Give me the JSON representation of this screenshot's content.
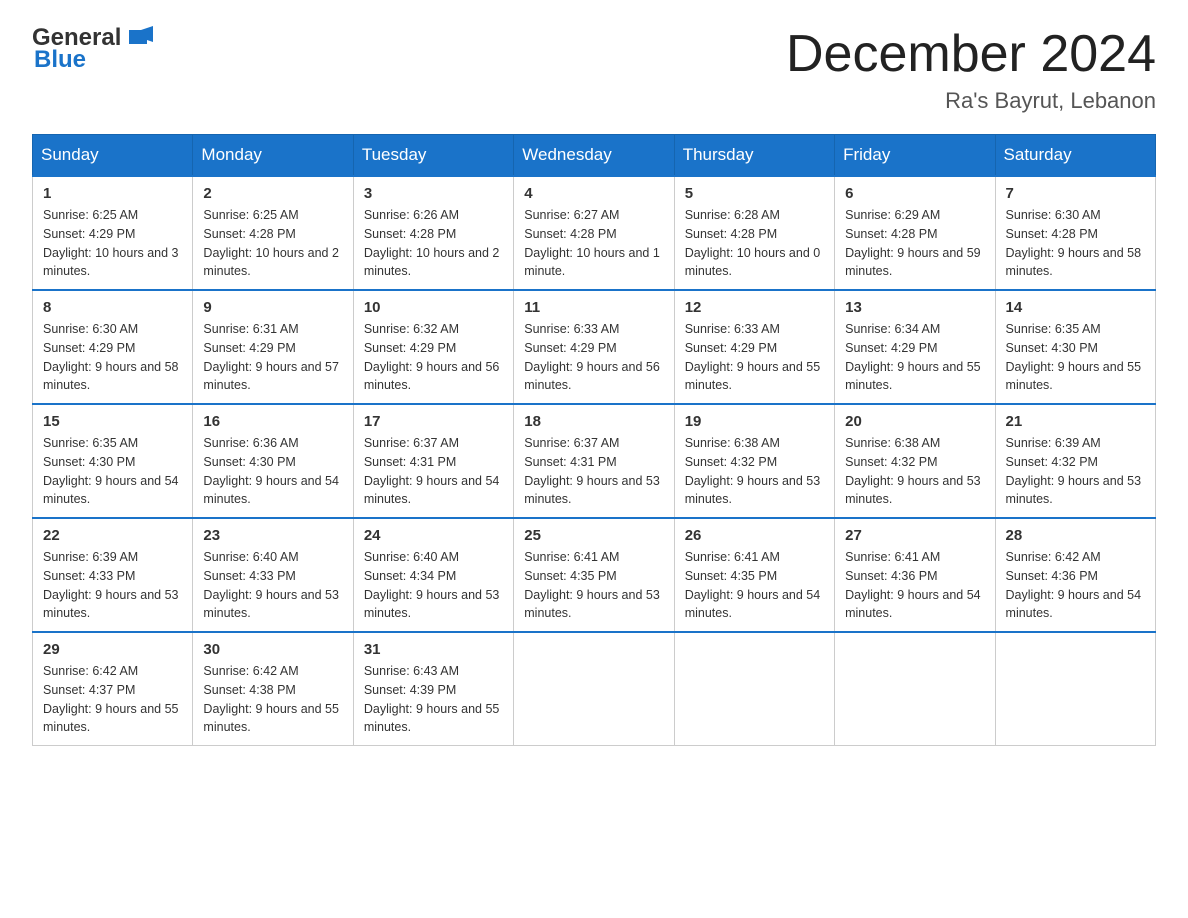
{
  "logo": {
    "text_general": "General",
    "text_blue": "Blue"
  },
  "header": {
    "title": "December 2024",
    "subtitle": "Ra's Bayrut, Lebanon"
  },
  "weekdays": [
    "Sunday",
    "Monday",
    "Tuesday",
    "Wednesday",
    "Thursday",
    "Friday",
    "Saturday"
  ],
  "weeks": [
    [
      {
        "day": "1",
        "sunrise": "6:25 AM",
        "sunset": "4:29 PM",
        "daylight": "10 hours and 3 minutes."
      },
      {
        "day": "2",
        "sunrise": "6:25 AM",
        "sunset": "4:28 PM",
        "daylight": "10 hours and 2 minutes."
      },
      {
        "day": "3",
        "sunrise": "6:26 AM",
        "sunset": "4:28 PM",
        "daylight": "10 hours and 2 minutes."
      },
      {
        "day": "4",
        "sunrise": "6:27 AM",
        "sunset": "4:28 PM",
        "daylight": "10 hours and 1 minute."
      },
      {
        "day": "5",
        "sunrise": "6:28 AM",
        "sunset": "4:28 PM",
        "daylight": "10 hours and 0 minutes."
      },
      {
        "day": "6",
        "sunrise": "6:29 AM",
        "sunset": "4:28 PM",
        "daylight": "9 hours and 59 minutes."
      },
      {
        "day": "7",
        "sunrise": "6:30 AM",
        "sunset": "4:28 PM",
        "daylight": "9 hours and 58 minutes."
      }
    ],
    [
      {
        "day": "8",
        "sunrise": "6:30 AM",
        "sunset": "4:29 PM",
        "daylight": "9 hours and 58 minutes."
      },
      {
        "day": "9",
        "sunrise": "6:31 AM",
        "sunset": "4:29 PM",
        "daylight": "9 hours and 57 minutes."
      },
      {
        "day": "10",
        "sunrise": "6:32 AM",
        "sunset": "4:29 PM",
        "daylight": "9 hours and 56 minutes."
      },
      {
        "day": "11",
        "sunrise": "6:33 AM",
        "sunset": "4:29 PM",
        "daylight": "9 hours and 56 minutes."
      },
      {
        "day": "12",
        "sunrise": "6:33 AM",
        "sunset": "4:29 PM",
        "daylight": "9 hours and 55 minutes."
      },
      {
        "day": "13",
        "sunrise": "6:34 AM",
        "sunset": "4:29 PM",
        "daylight": "9 hours and 55 minutes."
      },
      {
        "day": "14",
        "sunrise": "6:35 AM",
        "sunset": "4:30 PM",
        "daylight": "9 hours and 55 minutes."
      }
    ],
    [
      {
        "day": "15",
        "sunrise": "6:35 AM",
        "sunset": "4:30 PM",
        "daylight": "9 hours and 54 minutes."
      },
      {
        "day": "16",
        "sunrise": "6:36 AM",
        "sunset": "4:30 PM",
        "daylight": "9 hours and 54 minutes."
      },
      {
        "day": "17",
        "sunrise": "6:37 AM",
        "sunset": "4:31 PM",
        "daylight": "9 hours and 54 minutes."
      },
      {
        "day": "18",
        "sunrise": "6:37 AM",
        "sunset": "4:31 PM",
        "daylight": "9 hours and 53 minutes."
      },
      {
        "day": "19",
        "sunrise": "6:38 AM",
        "sunset": "4:32 PM",
        "daylight": "9 hours and 53 minutes."
      },
      {
        "day": "20",
        "sunrise": "6:38 AM",
        "sunset": "4:32 PM",
        "daylight": "9 hours and 53 minutes."
      },
      {
        "day": "21",
        "sunrise": "6:39 AM",
        "sunset": "4:32 PM",
        "daylight": "9 hours and 53 minutes."
      }
    ],
    [
      {
        "day": "22",
        "sunrise": "6:39 AM",
        "sunset": "4:33 PM",
        "daylight": "9 hours and 53 minutes."
      },
      {
        "day": "23",
        "sunrise": "6:40 AM",
        "sunset": "4:33 PM",
        "daylight": "9 hours and 53 minutes."
      },
      {
        "day": "24",
        "sunrise": "6:40 AM",
        "sunset": "4:34 PM",
        "daylight": "9 hours and 53 minutes."
      },
      {
        "day": "25",
        "sunrise": "6:41 AM",
        "sunset": "4:35 PM",
        "daylight": "9 hours and 53 minutes."
      },
      {
        "day": "26",
        "sunrise": "6:41 AM",
        "sunset": "4:35 PM",
        "daylight": "9 hours and 54 minutes."
      },
      {
        "day": "27",
        "sunrise": "6:41 AM",
        "sunset": "4:36 PM",
        "daylight": "9 hours and 54 minutes."
      },
      {
        "day": "28",
        "sunrise": "6:42 AM",
        "sunset": "4:36 PM",
        "daylight": "9 hours and 54 minutes."
      }
    ],
    [
      {
        "day": "29",
        "sunrise": "6:42 AM",
        "sunset": "4:37 PM",
        "daylight": "9 hours and 55 minutes."
      },
      {
        "day": "30",
        "sunrise": "6:42 AM",
        "sunset": "4:38 PM",
        "daylight": "9 hours and 55 minutes."
      },
      {
        "day": "31",
        "sunrise": "6:43 AM",
        "sunset": "4:39 PM",
        "daylight": "9 hours and 55 minutes."
      },
      null,
      null,
      null,
      null
    ]
  ]
}
